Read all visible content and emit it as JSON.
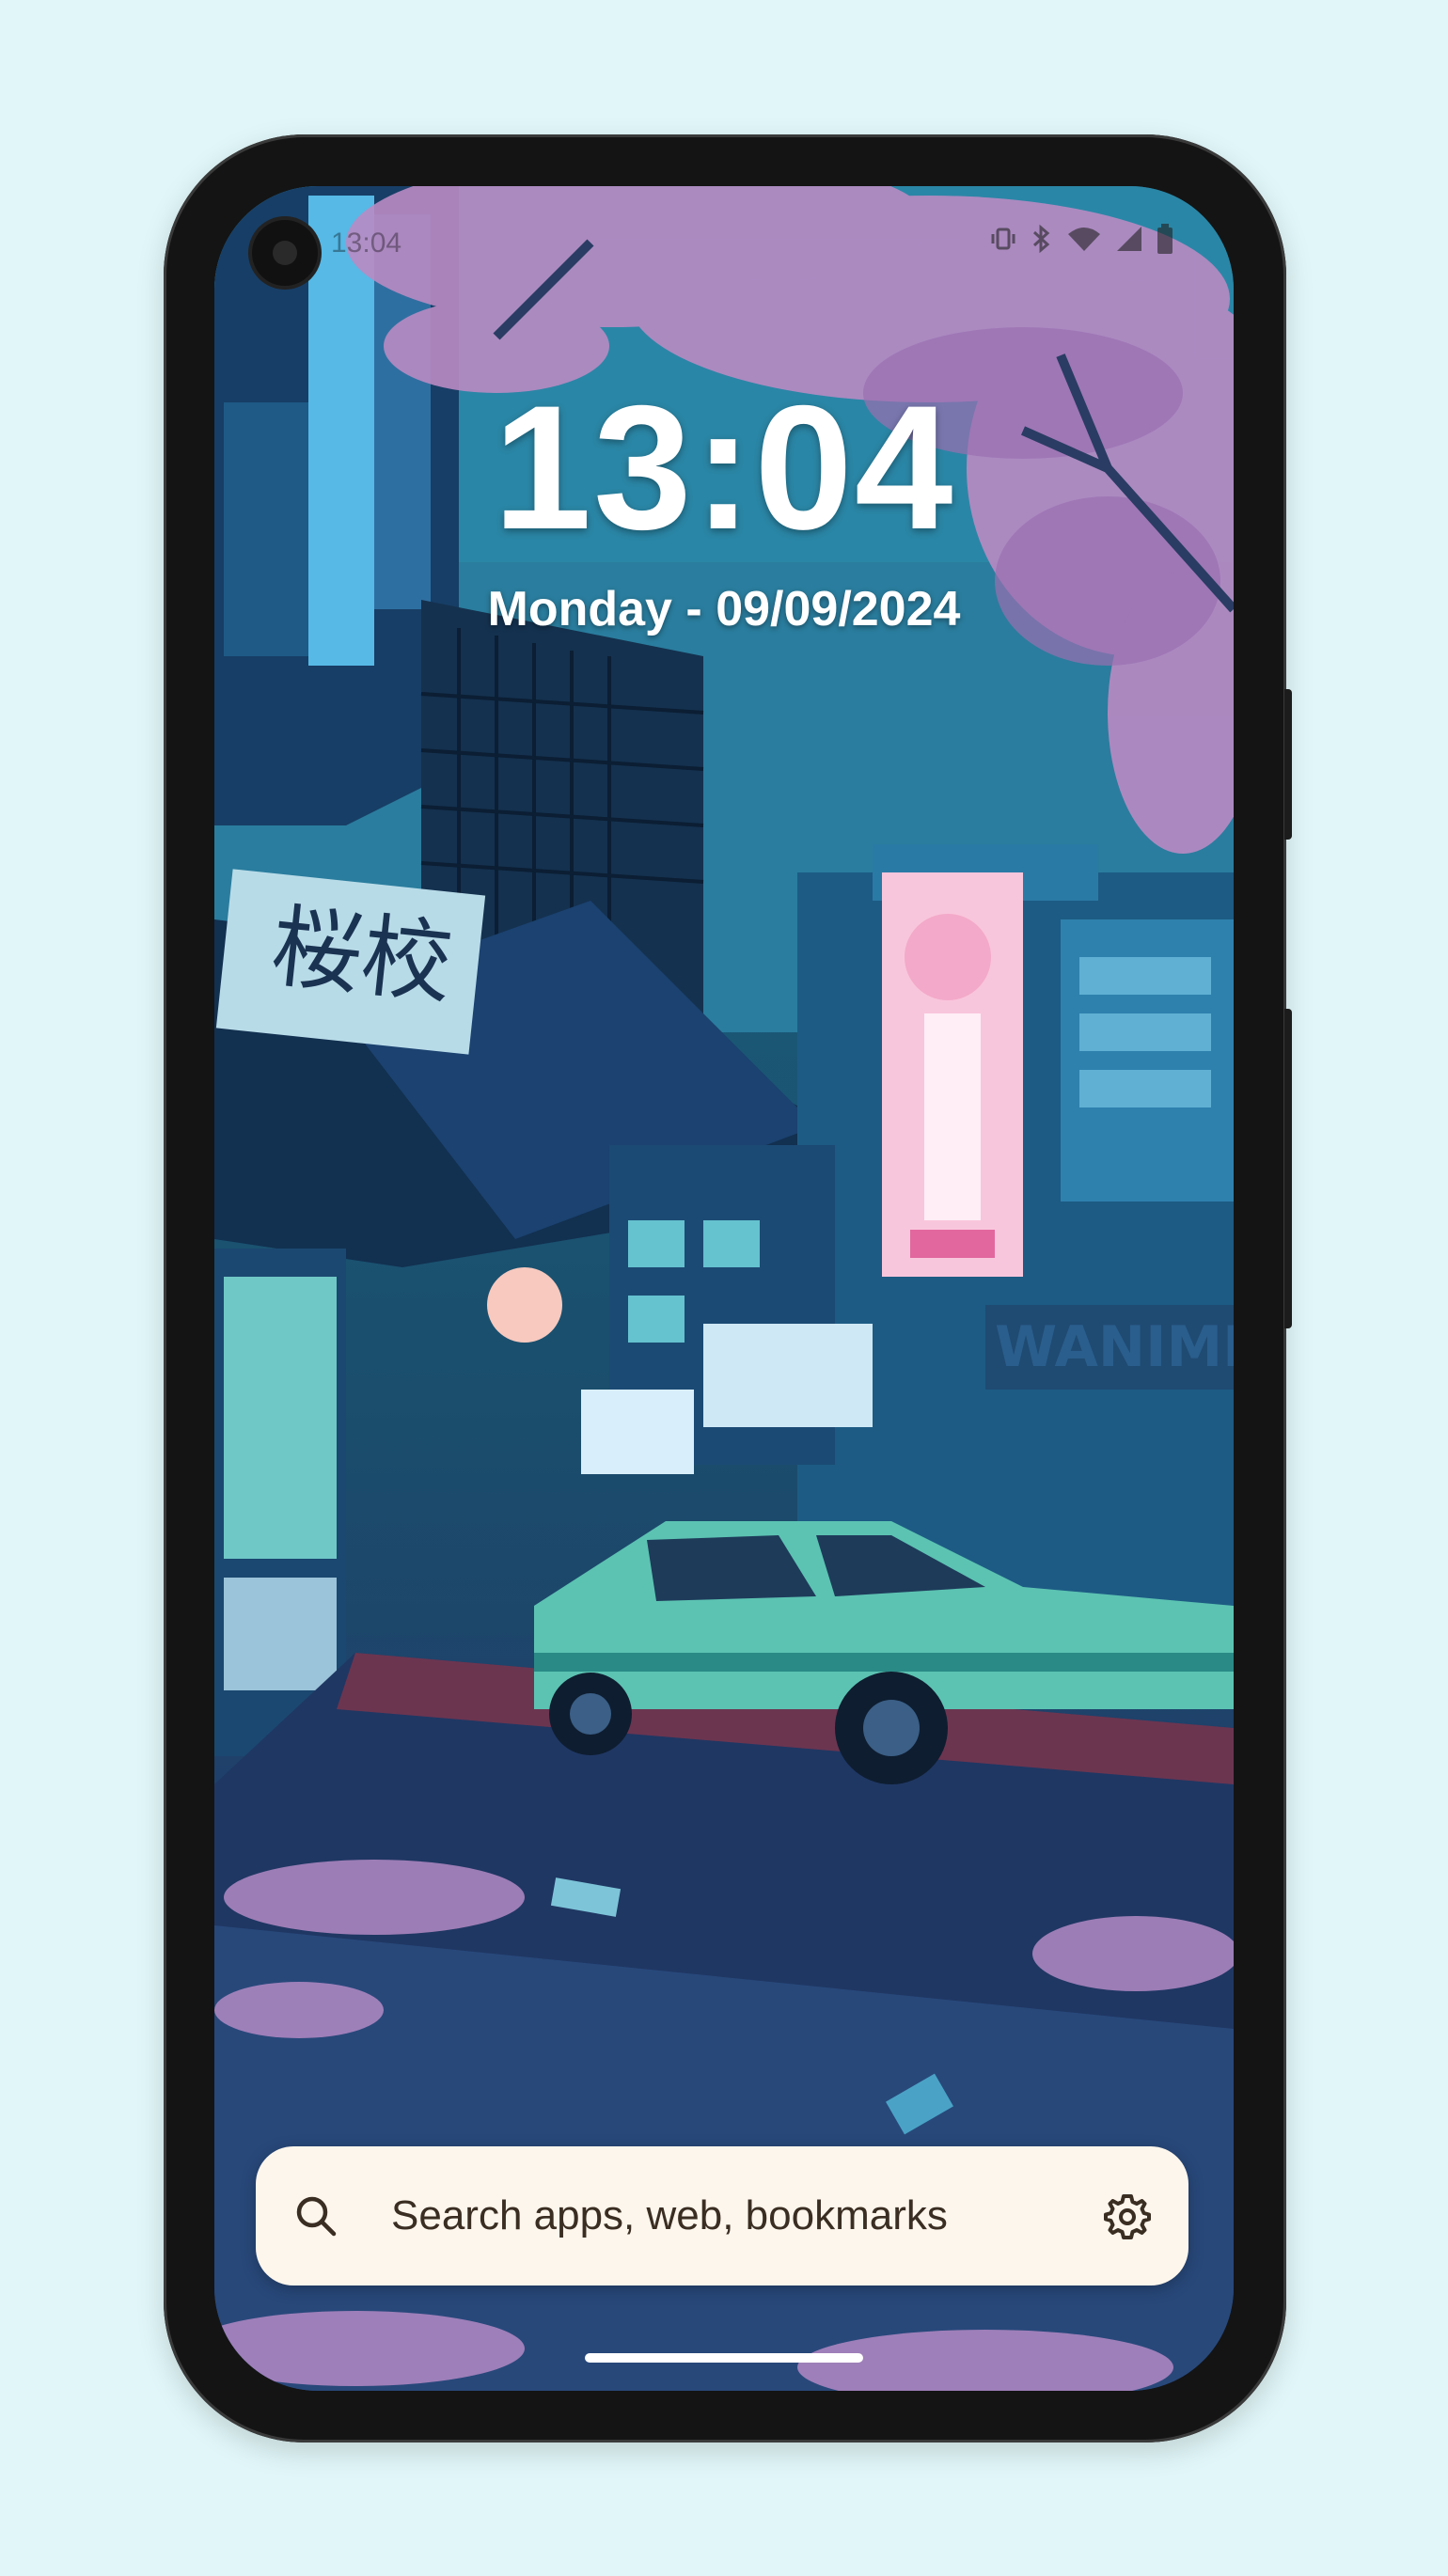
{
  "status_bar": {
    "time": "13:04",
    "icons": [
      "vibrate-icon",
      "bluetooth-icon",
      "wifi-icon",
      "signal-icon",
      "battery-icon"
    ]
  },
  "lock_screen": {
    "clock": "13:04",
    "date": "Monday - 09/09/2024"
  },
  "search": {
    "placeholder": "Search apps, web, bookmarks",
    "left_icon": "search-icon",
    "right_icon": "gear-icon"
  },
  "colors": {
    "background": "#e0f6f8",
    "search_bar_bg": "#fdf6ec",
    "search_text": "#3a2d22",
    "clock_text": "#ffffff"
  }
}
